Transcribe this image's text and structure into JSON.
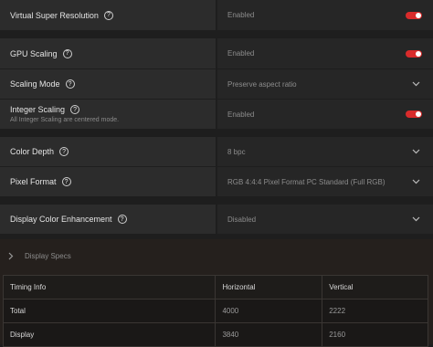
{
  "rows": [
    {
      "label": "Virtual Super Resolution",
      "help": "?",
      "value": "Enabled",
      "control": "toggle",
      "toggle_on": true
    },
    {
      "label": "GPU Scaling",
      "help": "?",
      "value": "Enabled",
      "control": "toggle",
      "toggle_on": true
    },
    {
      "label": "Scaling Mode",
      "help": "?",
      "value": "Preserve aspect ratio",
      "control": "dropdown"
    },
    {
      "label": "Integer Scaling",
      "help": "?",
      "sublabel": "All Integer Scaling are centered mode.",
      "value": "Enabled",
      "control": "toggle",
      "toggle_on": true
    },
    {
      "label": "Color Depth",
      "help": "?",
      "value": "8 bpc",
      "control": "dropdown"
    },
    {
      "label": "Pixel Format",
      "help": "?",
      "value": "RGB 4:4:4 Pixel Format PC Standard (Full RGB)",
      "control": "dropdown"
    },
    {
      "label": "Display Color Enhancement",
      "help": "?",
      "value": "Disabled",
      "control": "dropdown"
    }
  ],
  "specs": {
    "title": "Display Specs",
    "table": {
      "headers": [
        "Timing Info",
        "Horizontal",
        "Vertical"
      ],
      "rows": [
        [
          "Total",
          "4000",
          "2222"
        ],
        [
          "Display",
          "3840",
          "2160"
        ]
      ]
    }
  },
  "colors": {
    "accent": "#d92b2b",
    "panel": "#2c2c2c",
    "background": "#1e1e1e"
  }
}
